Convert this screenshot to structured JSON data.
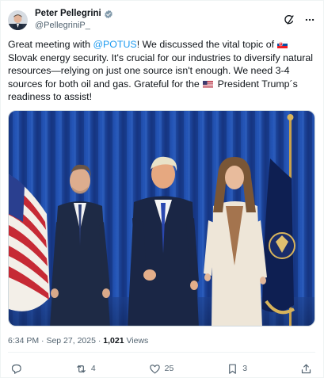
{
  "author": {
    "name": "Peter Pellegrini",
    "handle": "@PellegriniP_",
    "verified": true
  },
  "tweet": {
    "part1": "Great meeting with ",
    "mention": "@POTUS",
    "part2": "! We discussed the vital topic of ",
    "part3": "Slovak energy security. It's crucial for our industries to diversify natural resources—relying on just one source isn't enough. We need 3-4 sources for both oil and gas. Grateful for the ",
    "part4": " President Trump´s readiness to assist!",
    "flag1": "slovakia-flag",
    "flag2": "usa-flag"
  },
  "meta": {
    "time": "6:34 PM",
    "sep1": " · ",
    "date": "Sep 27, 2025",
    "sep2": " · ",
    "views_count": "1,021",
    "views_label": " Views"
  },
  "actions": {
    "reply_icon": "reply-icon",
    "repost_count": "4",
    "like_count": "25",
    "bookmark_count": "3",
    "share_icon": "share-icon"
  },
  "colors": {
    "accent": "#1d9bf0",
    "text": "#0f1419",
    "secondary": "#536471",
    "border": "#cfd9de"
  },
  "header_icons": [
    "grok-icon",
    "more-icon"
  ]
}
